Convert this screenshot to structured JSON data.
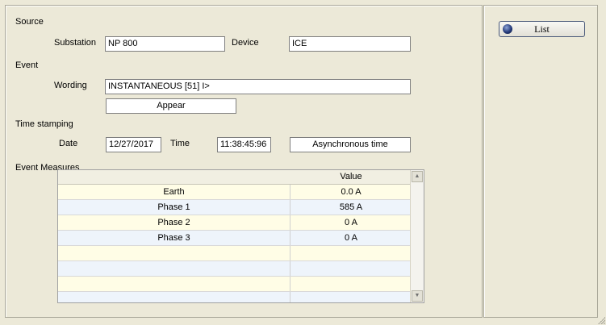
{
  "source": {
    "title": "Source",
    "substation_label": "Substation",
    "substation_value": "NP 800",
    "device_label": "Device",
    "device_value": "ICE"
  },
  "event": {
    "title": "Event",
    "wording_label": "Wording",
    "wording_value": "INSTANTANEOUS [51] I>",
    "state_value": "Appear"
  },
  "time_stamping": {
    "title": "Time stamping",
    "date_label": "Date",
    "date_value": "12/27/2017",
    "time_label": "Time",
    "time_value": "11:38:45:96",
    "sync_value": "Asynchronous time"
  },
  "measures": {
    "title": "Event Measures",
    "columns": [
      "",
      "Value"
    ],
    "rows": [
      {
        "name": "Earth",
        "value": "0.0 A"
      },
      {
        "name": "Phase 1",
        "value": "585 A"
      },
      {
        "name": "Phase 2",
        "value": "0 A"
      },
      {
        "name": "Phase 3",
        "value": "0 A"
      },
      {
        "name": "",
        "value": ""
      },
      {
        "name": "",
        "value": ""
      },
      {
        "name": "",
        "value": ""
      },
      {
        "name": "",
        "value": ""
      }
    ]
  },
  "actions": {
    "list_label": "List"
  },
  "icons": {
    "list_button_icon": "globe-icon",
    "scroll_up": "arrow-up-icon",
    "scroll_down": "arrow-down-icon",
    "resize": "resize-grip-icon"
  }
}
